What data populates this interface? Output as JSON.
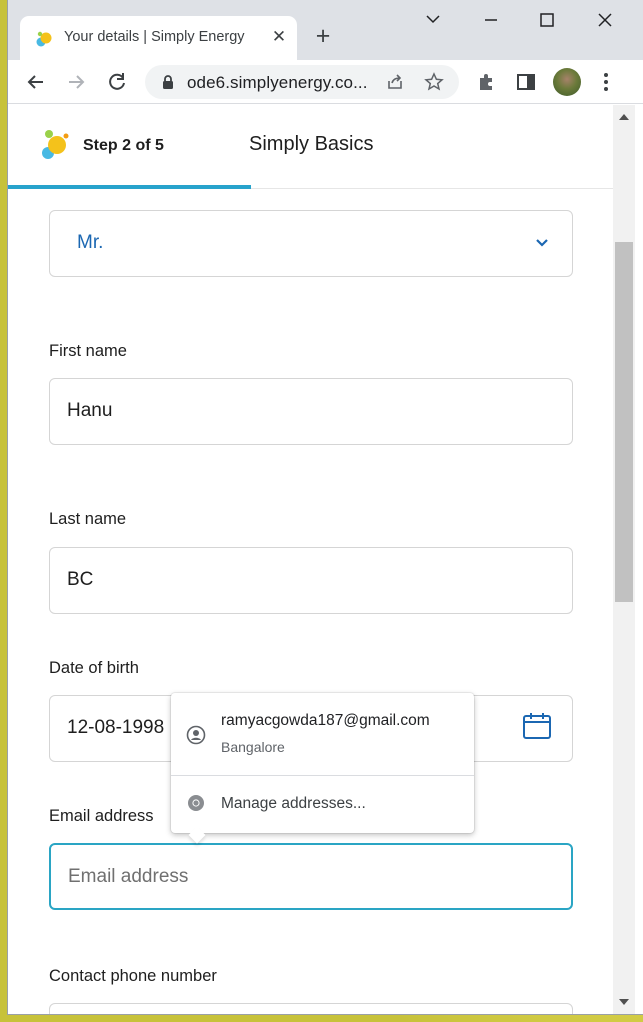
{
  "browser": {
    "tab_title": "Your details | Simply Energy",
    "url": "ode6.simplyenergy.co..."
  },
  "stepper": {
    "step_text": "Step 2 of 5",
    "plan_title": "Simply Basics"
  },
  "form": {
    "title_value": "Mr.",
    "first_name_label": "First name",
    "first_name_value": "Hanu",
    "last_name_label": "Last name",
    "last_name_value": "BC",
    "dob_label": "Date of birth",
    "dob_value": "12-08-1998",
    "email_label": "Email address",
    "email_placeholder": "Email address",
    "phone_label": "Contact phone number"
  },
  "autofill": {
    "suggestion_email": "ramyacgowda187@gmail.com",
    "suggestion_city": "Bangalore",
    "manage_label": "Manage addresses..."
  },
  "colors": {
    "accent": "#27a3cc",
    "link_blue": "#1b67b2"
  }
}
